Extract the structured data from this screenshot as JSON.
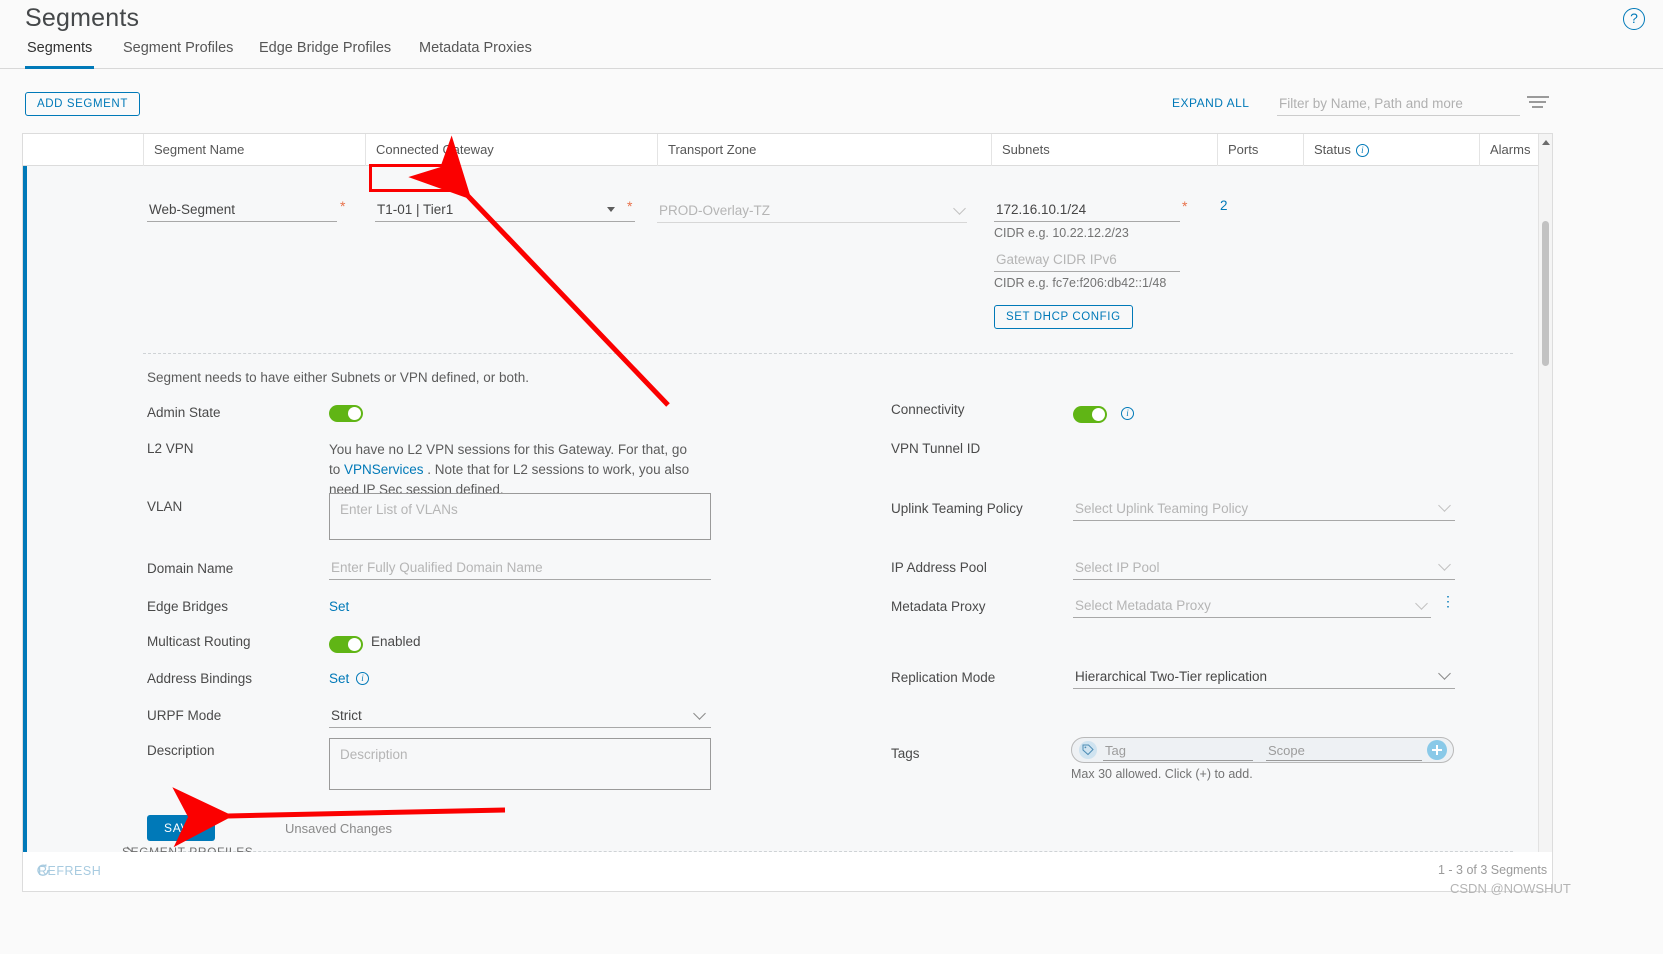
{
  "header": {
    "title": "Segments",
    "help_icon": "help-icon"
  },
  "tabs": [
    {
      "label": "Segments",
      "active": true
    },
    {
      "label": "Segment Profiles",
      "active": false
    },
    {
      "label": "Edge Bridge Profiles",
      "active": false
    },
    {
      "label": "Metadata Proxies",
      "active": false
    }
  ],
  "toolbar": {
    "add_segment_label": "ADD SEGMENT",
    "expand_all_label": "EXPAND ALL",
    "filter_placeholder": "Filter by Name, Path and more",
    "filter_value": ""
  },
  "columns": [
    {
      "label": "Segment Name"
    },
    {
      "label": "Connected Gateway"
    },
    {
      "label": "Transport Zone"
    },
    {
      "label": "Subnets"
    },
    {
      "label": "Ports"
    },
    {
      "label": "Status"
    },
    {
      "label": "Alarms"
    }
  ],
  "row": {
    "segment_name": "Web-Segment",
    "connected_gateway": "T1-01 | Tier1",
    "transport_zone": "PROD-Overlay-TZ",
    "subnet_ipv4": "172.16.10.1/24",
    "subnet_ipv4_hint": "CIDR e.g. 10.22.12.2/23",
    "subnet_ipv6_placeholder": "Gateway CIDR IPv6",
    "subnet_ipv6_hint": "CIDR e.g. fc7e:f206:db42::1/48",
    "set_dhcp_label": "SET DHCP CONFIG",
    "ports": "2"
  },
  "details": {
    "note": "Segment needs to have either Subnets or VPN defined, or both.",
    "left": {
      "admin_state_label": "Admin State",
      "admin_state_on": true,
      "l2vpn_label": "L2 VPN",
      "l2vpn_text_1": "You have no L2 VPN sessions for this Gateway. For that, go to ",
      "l2vpn_link_1": "VPN",
      "l2vpn_link_2": "Services",
      "l2vpn_text_2": " . Note that for L2 sessions to work, you also need IP Sec session defined.",
      "vlan_label": "VLAN",
      "vlan_placeholder": "Enter List of VLANs",
      "domain_name_label": "Domain Name",
      "domain_name_placeholder": "Enter Fully Qualified Domain Name",
      "edge_bridges_label": "Edge Bridges",
      "edge_bridges_action": "Set",
      "multicast_label": "Multicast Routing",
      "multicast_state": "Enabled",
      "address_bindings_label": "Address Bindings",
      "address_bindings_action": "Set",
      "urpf_label": "URPF Mode",
      "urpf_value": "Strict",
      "description_label": "Description",
      "description_placeholder": "Description"
    },
    "right": {
      "connectivity_label": "Connectivity",
      "connectivity_on": true,
      "vpn_tunnel_label": "VPN Tunnel ID",
      "uplink_label": "Uplink Teaming Policy",
      "uplink_placeholder": "Select Uplink Teaming Policy",
      "ip_pool_label": "IP Address Pool",
      "ip_pool_placeholder": "Select IP Pool",
      "metadata_proxy_label": "Metadata Proxy",
      "metadata_proxy_placeholder": "Select Metadata Proxy",
      "replication_label": "Replication Mode",
      "replication_value": "Hierarchical Two-Tier replication",
      "tags_label": "Tags",
      "tag_placeholder": "Tag",
      "scope_placeholder": "Scope",
      "tags_hint": "Max 30 allowed. Click (+) to add."
    },
    "save_label": "SAVE",
    "unsaved_label": "Unsaved Changes",
    "segment_profiles_label": "SEGMENT PROFILES"
  },
  "footer": {
    "refresh_label": "REFRESH",
    "count_label": "1 - 3 of 3 Segments",
    "watermark": "CSDN @NOWSHUT"
  },
  "colors": {
    "accent": "#0079b8",
    "toggle_on": "#60b515",
    "required": "#e8714a",
    "annotation": "#fb0000"
  }
}
